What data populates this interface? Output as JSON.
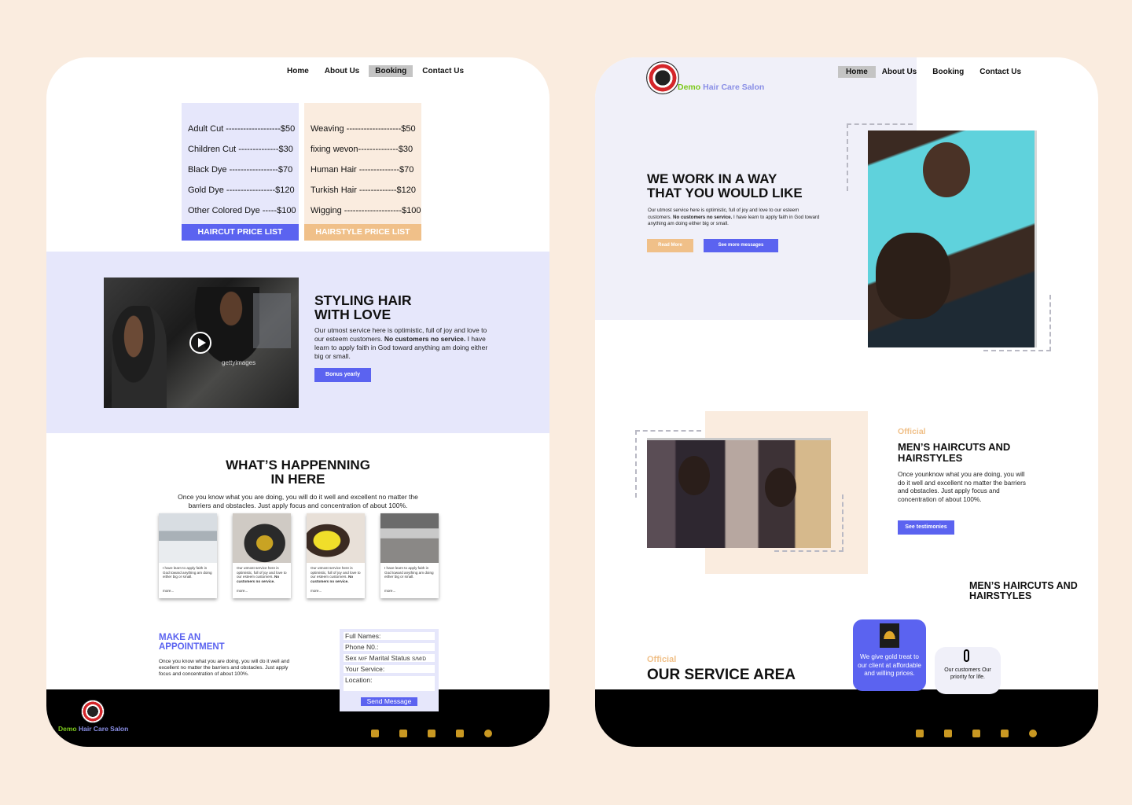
{
  "left": {
    "nav": [
      "Home",
      "About Us",
      "Booking",
      "Contact Us"
    ],
    "haircut": {
      "items": [
        "Adult Cut -------------------$50",
        "Children Cut --------------$30",
        "Black Dye -----------------$70",
        "Gold Dye -----------------$120",
        "Other Colored Dye -----$100"
      ],
      "label": "HAIRCUT PRICE LIST"
    },
    "hairstyle": {
      "items": [
        "Weaving -------------------$50",
        "fixing wevon--------------$30",
        "Human Hair --------------$70",
        "Turkish Hair -------------$120",
        "Wigging --------------------$100"
      ],
      "label": "HAIRSTYLE PRICE LIST"
    },
    "styling": {
      "title_1": "STYLING HAIR",
      "title_2": "WITH LOVE",
      "text_a": "Our utmost service here is optimistic, full of joy and love to our esteem customers. ",
      "text_b": "No customers no service.",
      "text_c": " I have learn to apply faith in God toward anything am doing either big or small.",
      "button": "Bonus yearly",
      "watermark": "gettyimages"
    },
    "happening": {
      "title_1": "WHAT’S HAPPENNING",
      "title_2": "IN HERE",
      "text": "Once you know what you are doing, you will do it well and excellent no matter the barriers and obstacles.  Just apply focus and concentration of about 100%.",
      "cards": [
        {
          "text": "I have learn to apply faith in God toward anything am doing either big or small.",
          "bold": "",
          "more": "more..."
        },
        {
          "text": "Our utmost service here is optimistic, full of joy and love to our esteem customers. ",
          "bold": "No customers no service.",
          "more": "more..."
        },
        {
          "text": "Our utmost service here is optimistic, full of joy and love to our esteem customers. ",
          "bold": "No customers no service.",
          "more": "more..."
        },
        {
          "text": "I have learn to apply faith in God toward anything am doing either big or small.",
          "bold": "",
          "more": "more..."
        }
      ]
    },
    "appointment": {
      "title_1": "MAKE AN",
      "title_2": "APPOINTMENT",
      "text": "Once you know what you are doing, you will do it well and excellent no matter the barriers and obstacles.  Just apply focus and concentration of about 100%."
    },
    "form": {
      "full_names": "Full Names:",
      "phone": "Phone N0.:",
      "sex": "Sex",
      "sex_opts": "M/F",
      "marital": "Marital Status",
      "marital_opts": "S/M/D",
      "service": "Your Service:",
      "location": "Location:",
      "send": "Send Message"
    },
    "logo": {
      "demo": "Demo",
      "rest": "Hair Care Salon"
    }
  },
  "right": {
    "nav": [
      "Home",
      "About Us",
      "Booking",
      "Contact Us"
    ],
    "logo": {
      "demo": "Demo",
      "rest": "Hair Care Salon"
    },
    "hero": {
      "title_1": "WE WORK IN A WAY",
      "title_2": "THAT YOU WOULD LIKE",
      "text_a": "Our utmost service here is optimistic, full of joy and love to our esteem customers. ",
      "text_b": "No customers no service.",
      "text_c": " I have learn to apply faith in God toward anything am doing either big or small.",
      "read_more": "Read More",
      "see_more": "See more messages"
    },
    "mens": {
      "official": "Official",
      "title_1": "MEN’S HAIRCUTS AND",
      "title_2": "HAIRSTYLES",
      "text": "Once younknow what you are doing, you will do it well and excellent no matter the barriers and obstacles.  Just apply focus and concentration of about 100%.",
      "button": "See testimonies"
    },
    "mens2": {
      "title_1": "MEN’S HAIRCUTS AND",
      "title_2": "HAIRSTYLES"
    },
    "service": {
      "official": "Official",
      "title": "OUR SERVICE AREA"
    },
    "blue_card": "We give gold treat to our client at affordable and willing prices.",
    "white_card": "Our customers Our priority for life."
  },
  "colors": {
    "accent": "#5b63f0",
    "orange": "#f0c089",
    "lavender": "#e6e7fb",
    "demo_green": "#7cc91c",
    "logo_blue": "#8a8fe6"
  }
}
